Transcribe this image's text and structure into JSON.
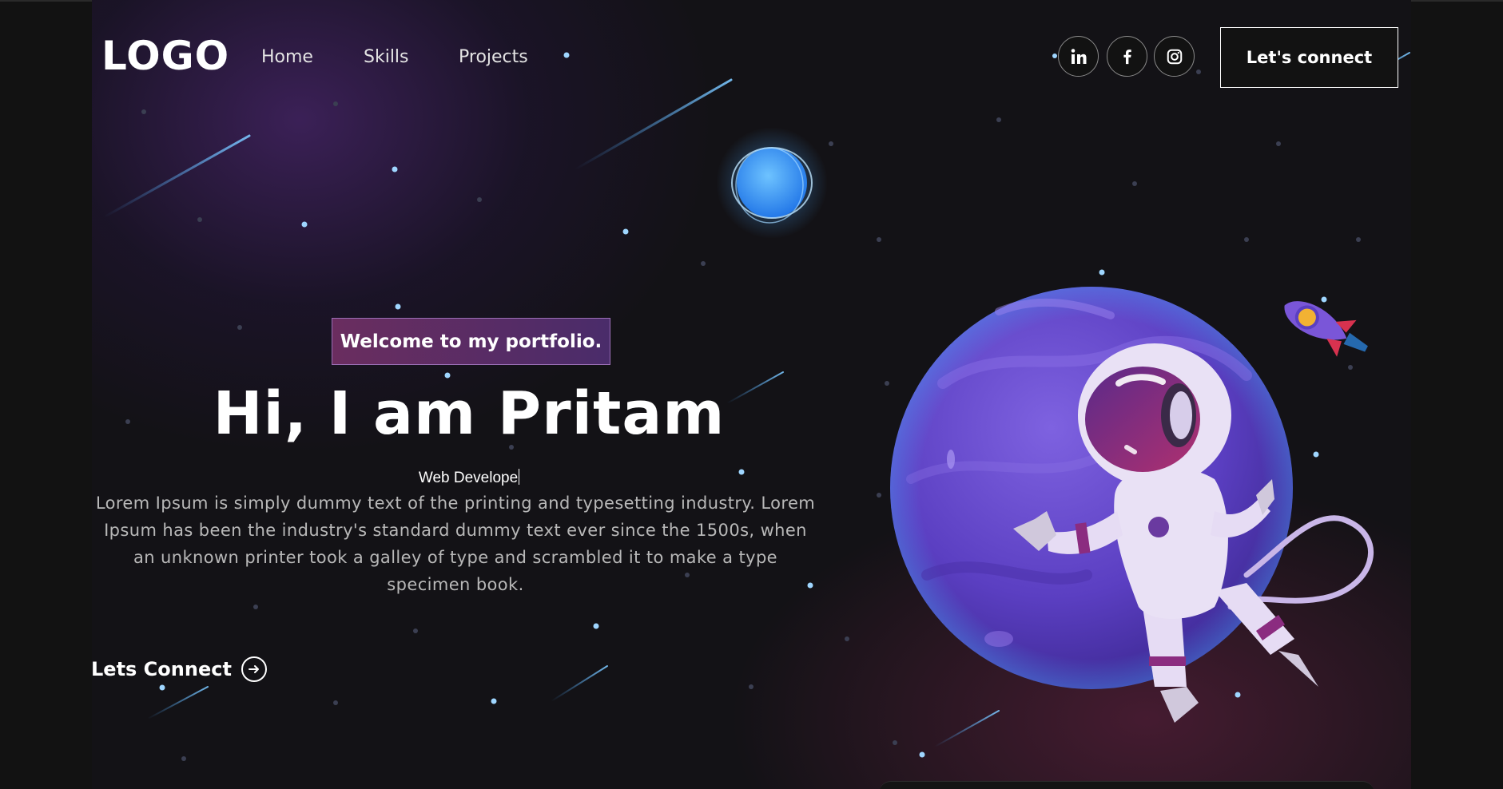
{
  "header": {
    "logo": "LOGO",
    "nav": [
      {
        "label": "Home"
      },
      {
        "label": "Skills"
      },
      {
        "label": "Projects"
      }
    ],
    "social": [
      "linkedin-icon",
      "facebook-icon",
      "instagram-icon"
    ],
    "connect_label": "Let's connect"
  },
  "hero": {
    "tagline": "Welcome to my portfolio.",
    "title": "Hi, I am Pritam",
    "role": "Web Develope",
    "description": "Lorem Ipsum is simply dummy text of the printing and typesetting industry. Lorem Ipsum has been the industry's standard dummy text ever since the 1500s, when an unknown printer took a galley of type and scrambled it to make a type specimen book.",
    "cta_label": "Lets Connect"
  },
  "colors": {
    "background": "#121212",
    "tagline_bg": "#5a2c64",
    "planet": "#6a4bd0",
    "accent_blue": "#4aa8ff"
  }
}
